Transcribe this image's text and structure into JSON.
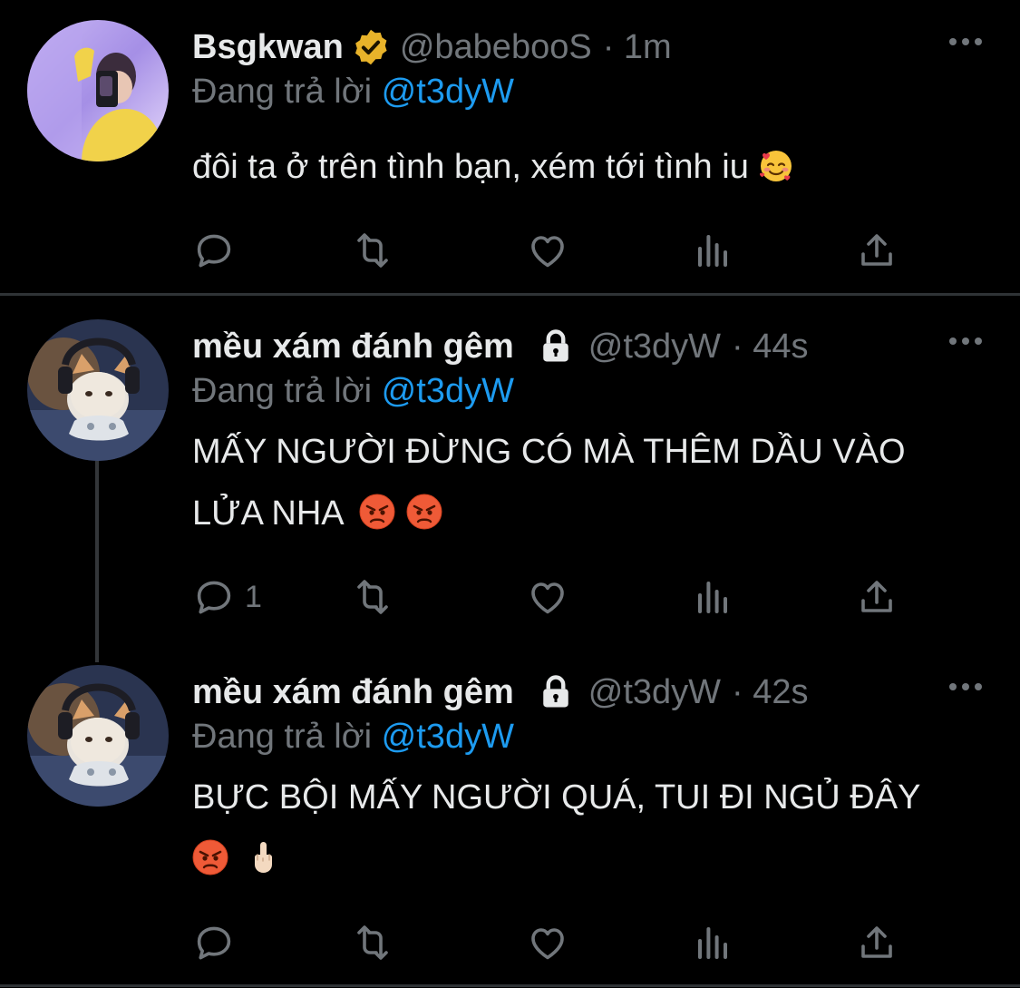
{
  "tweets": [
    {
      "name": "Bsgkwan",
      "handle": "@babebooS",
      "time": "· 1m",
      "verified": true,
      "replying_prefix": "Đang trả lời",
      "replying_to": "@t3dyW",
      "text": "đôi ta ở trên tình bạn, xém tới tình iu",
      "emojis": [
        "smiling-face-with-hearts"
      ],
      "reply_count": ""
    },
    {
      "name": "mều xám đánh gêm",
      "handle": "@t3dyW",
      "time": "· 44s",
      "locked": true,
      "replying_prefix": "Đang trả lời",
      "replying_to": "@t3dyW",
      "text_line1": "MẤY NGƯỜI ĐỪNG CÓ MÀ THÊM DẦU VÀO",
      "text_line2": "LỬA NHA",
      "emojis": [
        "angry-face",
        "angry-face"
      ],
      "reply_count": "1"
    },
    {
      "name": "mều xám đánh gêm",
      "handle": "@t3dyW",
      "time": "· 42s",
      "locked": true,
      "replying_prefix": "Đang trả lời",
      "replying_to": "@t3dyW",
      "text_line1": "BỰC BỘI MẤY NGƯỜI QUÁ, TUI ĐI NGỦ ĐÂY",
      "emojis": [
        "angry-face",
        "middle-finger"
      ],
      "reply_count": ""
    }
  ],
  "icons": [
    "reply-icon",
    "retweet-icon",
    "like-icon",
    "analytics-icon",
    "share-icon",
    "more-icon",
    "verified-badge-icon",
    "lock-icon"
  ],
  "colors": {
    "background": "#000000",
    "text": "#e7e9ea",
    "muted": "#71767b",
    "mention": "#1d9bf0",
    "badge": "#e8b32a",
    "divider": "#2f3336"
  }
}
